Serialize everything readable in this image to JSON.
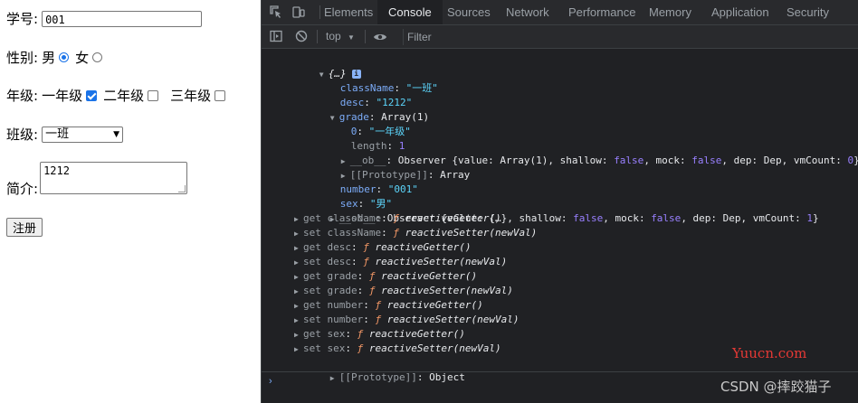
{
  "form": {
    "student_id_label": "学号:",
    "student_id_value": "001",
    "gender_label": "性别:",
    "gender_male": "男",
    "gender_female": "女",
    "grade_label": "年级:",
    "grade_1": "一年级",
    "grade_2": "二年级",
    "grade_3": "三年级",
    "class_label": "班级:",
    "class_value": "一班",
    "intro_label": "简介:",
    "intro_value": "1212",
    "submit_label": "注册",
    "states": {
      "male_checked": true,
      "female_checked": false,
      "grade1_checked": true,
      "grade2_checked": false,
      "grade3_checked": false
    }
  },
  "devtools": {
    "tabs": [
      "Elements",
      "Console",
      "Sources",
      "Network",
      "Performance",
      "Memory",
      "Application",
      "Security"
    ],
    "active_tab": "Console",
    "context": "top",
    "filter_placeholder": "Filter",
    "object_header": "{…}",
    "info_badge": "i",
    "props": {
      "className_key": "className",
      "className_val": "\"一班\"",
      "desc_key": "desc",
      "desc_val": "\"1212\"",
      "grade_key": "grade",
      "grade_val": "Array(1)",
      "grade_0_key": "0",
      "grade_0_val": "\"一年级\"",
      "length_key": "length",
      "length_val": "1",
      "ob_key": "__ob__",
      "proto_key": "[[Prototype]]",
      "proto_array": "Array",
      "number_key": "number",
      "number_val": "\"001\"",
      "sex_key": "sex",
      "sex_val": "\"男\"",
      "proto_object": "Object"
    },
    "observer_inner": {
      "prefix": "Observer {value: ",
      "value": "Array(1)",
      "shallow_lbl": ", shallow: ",
      "false": "false",
      "mock_lbl": ", mock: ",
      "dep_lbl": ", dep: ",
      "dep": "Dep",
      "vm_lbl": ", vmCount: ",
      "vm0": "0",
      "close": "}"
    },
    "observer_outer": {
      "value": "{…}",
      "vm1": "1"
    },
    "accessors": [
      {
        "kind": "get",
        "name": "className",
        "fn": "reactiveGetter()"
      },
      {
        "kind": "set",
        "name": "className",
        "fn": "reactiveSetter(newVal)"
      },
      {
        "kind": "get",
        "name": "desc",
        "fn": "reactiveGetter()"
      },
      {
        "kind": "set",
        "name": "desc",
        "fn": "reactiveSetter(newVal)"
      },
      {
        "kind": "get",
        "name": "grade",
        "fn": "reactiveGetter()"
      },
      {
        "kind": "set",
        "name": "grade",
        "fn": "reactiveSetter(newVal)"
      },
      {
        "kind": "get",
        "name": "number",
        "fn": "reactiveGetter()"
      },
      {
        "kind": "set",
        "name": "number",
        "fn": "reactiveSetter(newVal)"
      },
      {
        "kind": "get",
        "name": "sex",
        "fn": "reactiveGetter()"
      },
      {
        "kind": "set",
        "name": "sex",
        "fn": "reactiveSetter(newVal)"
      }
    ],
    "f_symbol": "ƒ",
    "watermark_site": "Yuucn.com",
    "watermark_author": "CSDN @摔跤猫子",
    "prompt_caret": "›"
  },
  "colors": {
    "devtools_bg": "#202124",
    "key": "#7cacf8",
    "string": "#5cd5fb",
    "keyword": "#9980ff",
    "function": "#f29766",
    "checked": "#1a73e8",
    "watermark": "#e53935"
  },
  "icons": [
    "inspect-icon",
    "device-toggle-icon",
    "sidebar-icon",
    "clear-console-icon",
    "eye-icon",
    "dropdown-arrow-icon",
    "info-icon"
  ]
}
